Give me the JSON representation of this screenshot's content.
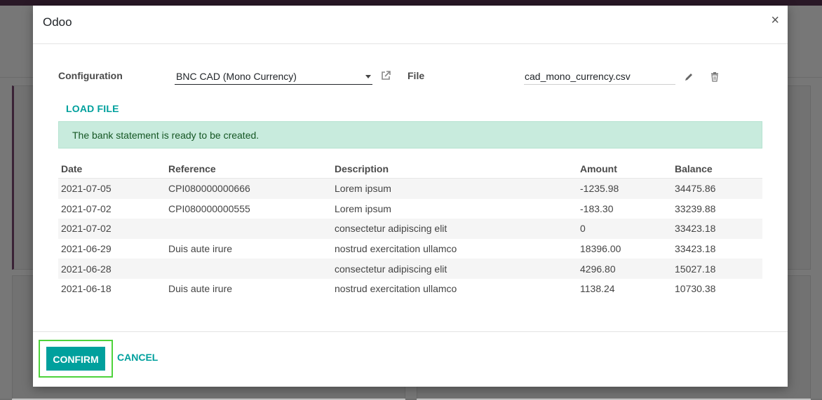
{
  "modal": {
    "title": "Odoo",
    "close": "×"
  },
  "form": {
    "configuration_label": "Configuration",
    "configuration_value": "BNC CAD (Mono Currency)",
    "file_label": "File",
    "file_value": "cad_mono_currency.csv"
  },
  "load_file_label": "LOAD FILE",
  "alert_text": "The bank statement is ready to be created.",
  "table": {
    "headers": [
      "Date",
      "Reference",
      "Description",
      "Amount",
      "Balance"
    ],
    "rows": [
      [
        "2021-07-05",
        "CPI080000000666",
        "Lorem ipsum",
        "-1235.98",
        "34475.86"
      ],
      [
        "2021-07-02",
        "CPI080000000555",
        "Lorem ipsum",
        "-183.30",
        "33239.88"
      ],
      [
        "2021-07-02",
        "",
        "consectetur adipiscing elit",
        "0",
        "33423.18"
      ],
      [
        "2021-06-29",
        "Duis aute irure",
        "nostrud exercitation ullamco",
        "18396.00",
        "33423.18"
      ],
      [
        "2021-06-28",
        "",
        "consectetur adipiscing elit",
        "4296.80",
        "15027.18"
      ],
      [
        "2021-06-18",
        "Duis aute irure",
        "nostrud exercitation ullamco",
        "1138.24",
        "10730.38"
      ]
    ]
  },
  "footer": {
    "confirm_label": "CONFIRM",
    "cancel_label": "CANCEL"
  },
  "colors": {
    "accent": "#00a09d",
    "alert_bg": "#c8ebdd",
    "highlight": "#4ed33b"
  },
  "icons": {
    "external_link": "external-link-icon",
    "edit": "pencil-icon",
    "delete": "trash-icon",
    "close": "close-icon"
  }
}
